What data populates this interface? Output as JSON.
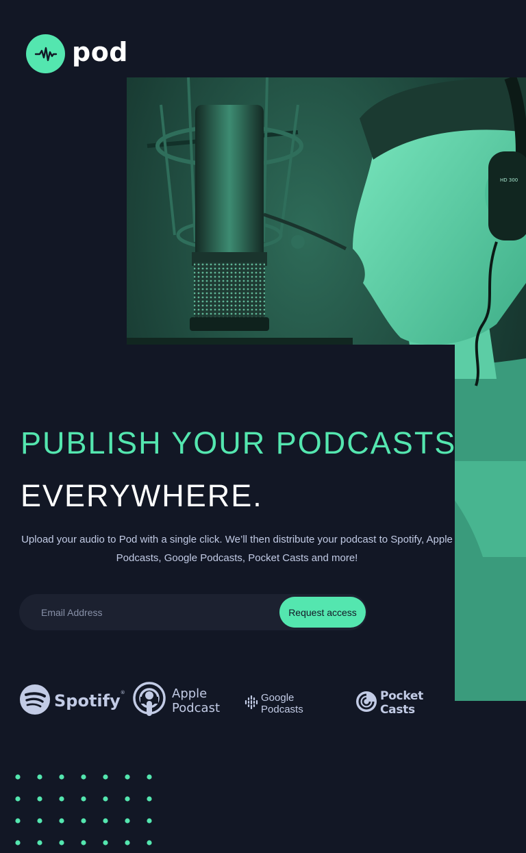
{
  "brand": {
    "name": "pod",
    "logo_icon": "waveform-icon",
    "accent": "#54e6af",
    "background": "#121725"
  },
  "hero": {
    "description": "man singing into studio microphone wearing headphones"
  },
  "headline": {
    "line1": "PUBLISH YOUR PODCASTS",
    "line2": "EVERYWHERE."
  },
  "description": "Upload your audio to Pod with a single click. We’ll then distribute your podcast to Spotify, Apple Podcasts, Google Podcasts, Pocket Casts and more!",
  "form": {
    "email_placeholder": "Email Address",
    "button_label": "Request access"
  },
  "platforms": [
    {
      "name": "Spotify",
      "icon": "spotify-icon"
    },
    {
      "name_line1": "Apple",
      "name_line2": "Podcast",
      "icon": "apple-podcasts-icon"
    },
    {
      "name": "Google Podcasts",
      "icon": "google-podcasts-icon"
    },
    {
      "name": "Pocket Casts",
      "icon": "pocket-casts-icon"
    }
  ],
  "spotify_mark": "®"
}
